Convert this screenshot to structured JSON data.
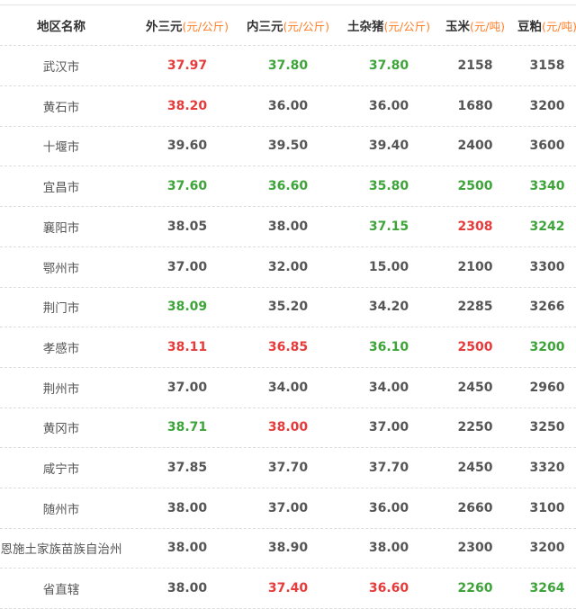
{
  "colors": {
    "black": "#555555",
    "red": "#e53b3b",
    "green": "#3ea43a",
    "unit": "#ff7f27"
  },
  "header": {
    "region": "地区名称",
    "col1": {
      "name": "外三元",
      "unit": "(元/公斤)"
    },
    "col2": {
      "name": "内三元",
      "unit": "(元/公斤)"
    },
    "col3": {
      "name": "土杂猪",
      "unit": "(元/公斤)"
    },
    "col4": {
      "name": "玉米",
      "unit": "(元/吨)"
    },
    "col5": {
      "name": "豆粕",
      "unit": "(元/吨)"
    }
  },
  "rows": [
    {
      "region": "武汉市",
      "values": [
        "37.97",
        "37.80",
        "37.80",
        "2158",
        "3158"
      ],
      "colors": [
        "red",
        "green",
        "green",
        "black",
        "black"
      ]
    },
    {
      "region": "黄石市",
      "values": [
        "38.20",
        "36.00",
        "36.00",
        "1680",
        "3200"
      ],
      "colors": [
        "red",
        "black",
        "black",
        "black",
        "black"
      ]
    },
    {
      "region": "十堰市",
      "values": [
        "39.60",
        "39.50",
        "39.40",
        "2400",
        "3600"
      ],
      "colors": [
        "black",
        "black",
        "black",
        "black",
        "black"
      ]
    },
    {
      "region": "宜昌市",
      "values": [
        "37.60",
        "36.60",
        "35.80",
        "2500",
        "3340"
      ],
      "colors": [
        "green",
        "green",
        "green",
        "green",
        "green"
      ]
    },
    {
      "region": "襄阳市",
      "values": [
        "38.05",
        "38.00",
        "37.15",
        "2308",
        "3242"
      ],
      "colors": [
        "black",
        "black",
        "green",
        "red",
        "green"
      ]
    },
    {
      "region": "鄂州市",
      "values": [
        "37.00",
        "32.00",
        "15.00",
        "2100",
        "3300"
      ],
      "colors": [
        "black",
        "black",
        "black",
        "black",
        "black"
      ]
    },
    {
      "region": "荆门市",
      "values": [
        "38.09",
        "35.20",
        "34.20",
        "2285",
        "3266"
      ],
      "colors": [
        "green",
        "black",
        "black",
        "black",
        "black"
      ]
    },
    {
      "region": "孝感市",
      "values": [
        "38.11",
        "36.85",
        "36.10",
        "2500",
        "3200"
      ],
      "colors": [
        "red",
        "red",
        "green",
        "red",
        "green"
      ]
    },
    {
      "region": "荆州市",
      "values": [
        "37.00",
        "34.00",
        "34.00",
        "2450",
        "2960"
      ],
      "colors": [
        "black",
        "black",
        "black",
        "black",
        "black"
      ]
    },
    {
      "region": "黄冈市",
      "values": [
        "38.71",
        "38.00",
        "37.00",
        "2250",
        "3250"
      ],
      "colors": [
        "green",
        "red",
        "black",
        "black",
        "black"
      ]
    },
    {
      "region": "咸宁市",
      "values": [
        "37.85",
        "37.70",
        "37.70",
        "2450",
        "3320"
      ],
      "colors": [
        "black",
        "black",
        "black",
        "black",
        "black"
      ]
    },
    {
      "region": "随州市",
      "values": [
        "38.00",
        "37.00",
        "36.00",
        "2660",
        "3100"
      ],
      "colors": [
        "black",
        "black",
        "black",
        "black",
        "black"
      ]
    },
    {
      "region": "恩施土家族苗族自治州",
      "values": [
        "38.00",
        "38.90",
        "38.00",
        "2300",
        "3200"
      ],
      "colors": [
        "black",
        "black",
        "black",
        "black",
        "black"
      ]
    },
    {
      "region": "省直辖",
      "values": [
        "38.00",
        "37.40",
        "36.60",
        "2260",
        "3264"
      ],
      "colors": [
        "black",
        "red",
        "red",
        "green",
        "green"
      ]
    }
  ]
}
